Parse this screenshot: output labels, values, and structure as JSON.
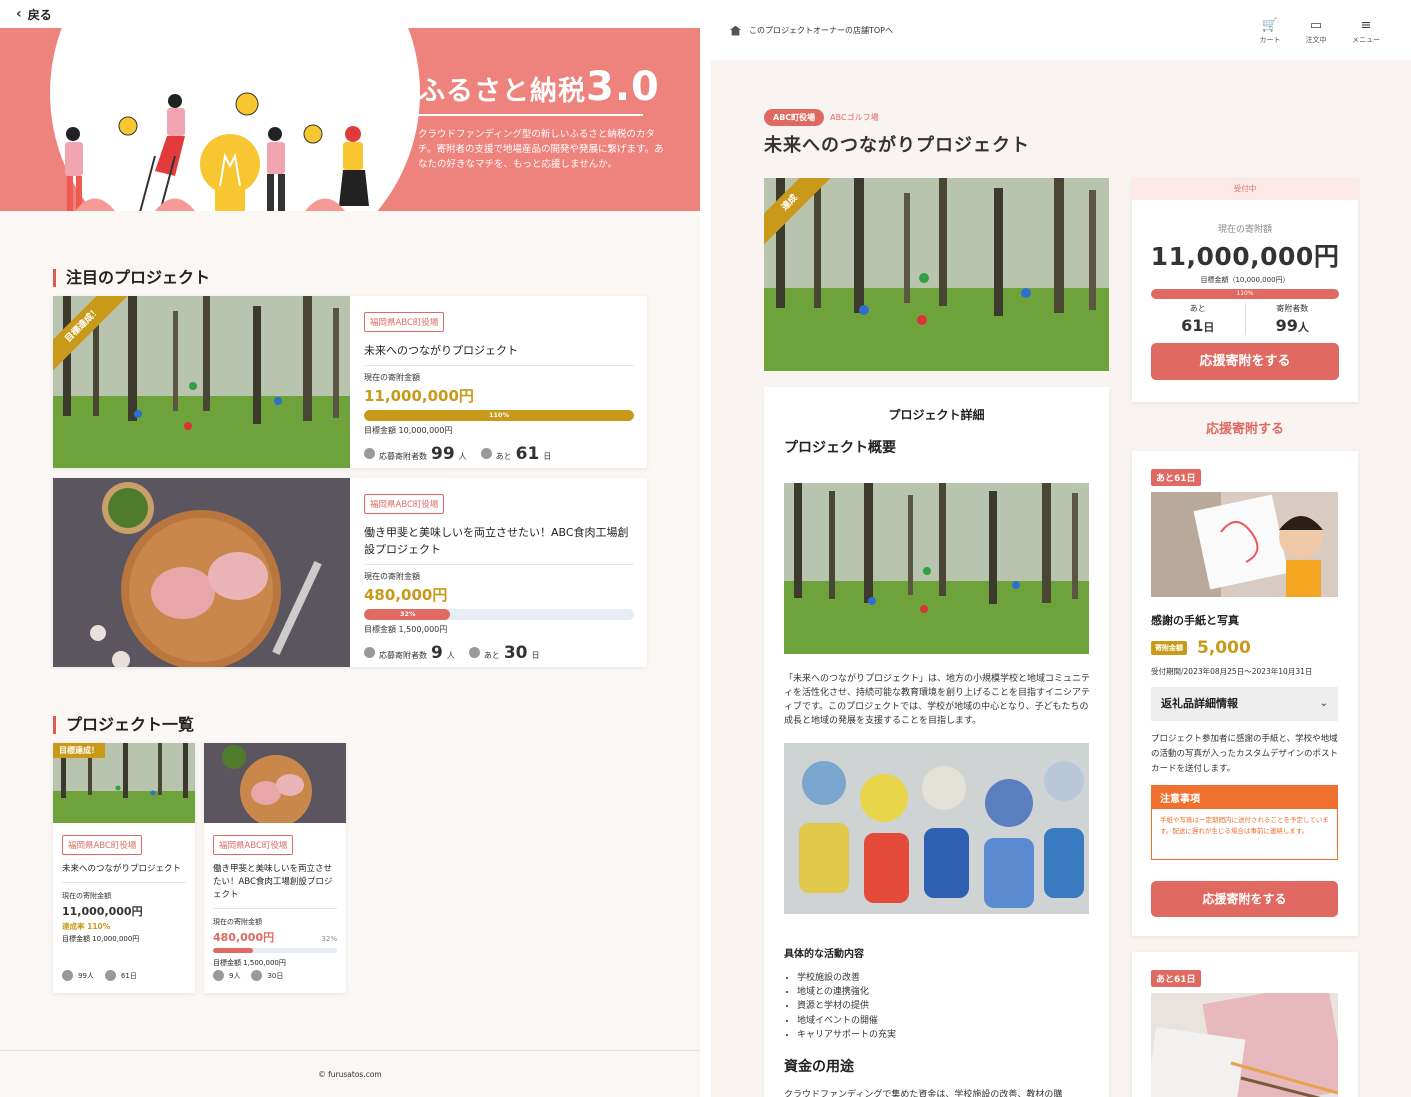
{
  "left": {
    "back_label": "戻る",
    "hero": {
      "title_main": "ふるさと納税",
      "title_version": "3.0",
      "description": "クラウドファンディング型の新しいふるさと納税のカタチ。寄附者の支援で地場産品の開発や発展に繋げます。あなたの好きなマチを、もっと応援しませんか。"
    },
    "featured_heading": "注目のプロジェクト",
    "featured": [
      {
        "badge": "目標達成！",
        "org": "福岡県ABC町役場",
        "title": "未来へのつながりプロジェクト",
        "current_label": "現在の寄附金額",
        "amount": "11,000,000円",
        "progress_label": "110%",
        "progress": 1.0,
        "goal": "目標金額 10,000,000円",
        "donors_label": "応募寄附者数",
        "donors": "99",
        "donors_unit": "人",
        "days_label": "あと",
        "days": "61",
        "days_unit": "日"
      },
      {
        "org": "福岡県ABC町役場",
        "title": "働き甲斐と美味しいを両立させたい！ABC食肉工場創設プロジェクト",
        "current_label": "現在の寄附金額",
        "amount": "480,000円",
        "progress_label": "32%",
        "progress": 0.32,
        "goal": "目標金額 1,500,000円",
        "donors_label": "応募寄附者数",
        "donors": "9",
        "donors_unit": "人",
        "days_label": "あと",
        "days": "30",
        "days_unit": "日"
      }
    ],
    "list_heading": "プロジェクト一覧",
    "list": [
      {
        "badge": "目標達成！",
        "org": "福岡県ABC町役場",
        "title": "未来へのつながりプロジェクト",
        "current_label": "現在の寄附金額",
        "amount": "11,000,000円",
        "rate": "達成率 110%",
        "goal": "目標金額 10,000,000円",
        "donors": "99人",
        "days": "61日"
      },
      {
        "org": "福岡県ABC町役場",
        "title": "働き甲斐と美味しいを両立させたい！ABC食肉工場創設プロジェクト",
        "current_label": "現在の寄附金額",
        "amount": "480,000円",
        "rate": "32%",
        "progress": 0.32,
        "goal": "目標金額 1,500,000円",
        "donors": "9人",
        "days": "30日"
      }
    ],
    "footer": "© furusatos.com"
  },
  "right": {
    "topbar": {
      "store_link": "このプロジェクトオーナーの店舗TOPへ",
      "cart": "カート",
      "orders": "注文中",
      "menu": "メニュー"
    },
    "tag_primary": "ABC町役場",
    "tag_secondary": "ABCゴルフ場",
    "title": "未来へのつながりプロジェクト",
    "main_ribbon": "達成",
    "status": {
      "header": "受付中",
      "current_label": "現在の寄附額",
      "amount": "11,000,000円",
      "goal": "目標金額（10,000,000円）",
      "progress_label": "110%",
      "progress": 1.1,
      "remaining_label": "あと",
      "remaining": "61",
      "remaining_unit": "日",
      "donors_label": "寄附者数",
      "donors": "99",
      "donors_unit": "人",
      "button": "応援寄附をする"
    },
    "detail": {
      "heading": "プロジェクト詳細",
      "overview_heading": "プロジェクト概要",
      "overview_text": "「未来へのつながりプロジェクト」は、地方の小規模学校と地域コミュニティを活性化させ、持続可能な教育環境を創り上げることを目指すイニシアティブです。このプロジェクトでは、学校が地域の中心となり、子どもたちの成長と地域の発展を支援することを目指します。",
      "activities_heading": "具体的な活動内容",
      "activities": [
        "学校施設の改善",
        "地域との連携強化",
        "資源と学材の提供",
        "地域イベントの開催",
        "キャリアサポートの充実"
      ],
      "funds_heading": "資金の用途",
      "funds_text": "クラウドファンディングで集めた資金は、学校施設の改善、教材の購"
    },
    "support_heading": "応援寄附する",
    "reward": {
      "remaining": "あと61日",
      "title": "感謝の手紙と写真",
      "price_label": "寄附金額",
      "price": "5,000",
      "period": "受付期間/2023年08月25日〜2023年10月31日",
      "accordion": "返礼品詳細情報",
      "description": "プロジェクト参加者に感謝の手紙と、学校や地域の活動の写真が入ったカスタムデザインのポストカードを送付します。",
      "notice_heading": "注意事項",
      "notice_text": "手紙や写真は一定期間内に送付されることを予定しています。配送に遅れが生じる場合は事前に連絡します。",
      "button": "応援寄附をする"
    },
    "reward2": {
      "remaining": "あと61日"
    }
  }
}
